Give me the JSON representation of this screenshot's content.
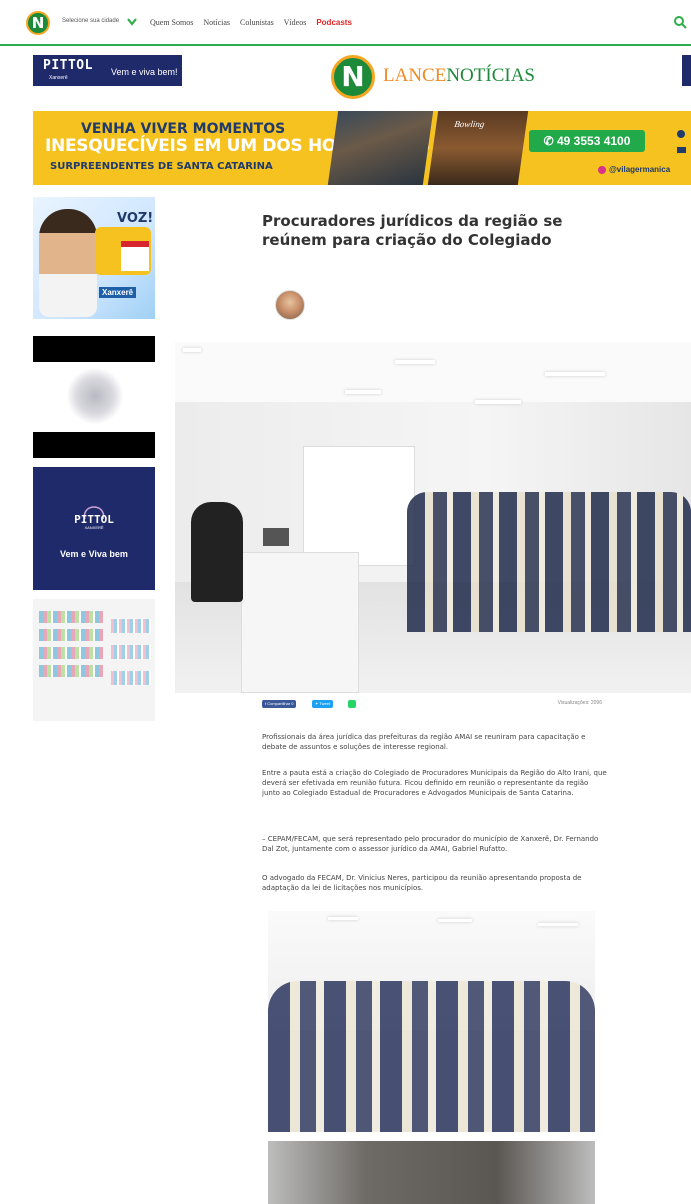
{
  "nav": {
    "city_select": "Selecione sua cidade",
    "links": [
      "Quem Somos",
      "Notícias",
      "Colunistas",
      "Vídeos"
    ],
    "podcasts": "Podcasts",
    "logo_letter": "N"
  },
  "header": {
    "ad_pittol": {
      "brand": "PITTOL",
      "sub": "Xanxerê",
      "tagline": "Vem e viva bem!"
    },
    "logo": {
      "letter": "N",
      "brand_part1": "LANCE",
      "brand_part2": "NOTÍCIAS"
    }
  },
  "hotel_banner": {
    "line1": "VENHA VIVER MOMENTOS",
    "line2": "INESQUECÍVEIS EM UM DOS HOTÉIS MAIS",
    "line3": "SURPREENDENTES DE SANTA CATARINA",
    "photo_caption": "Bowling",
    "phone": "49 3553 4100",
    "instagram": "@vilagermanica"
  },
  "sidebar": {
    "ad_voz": {
      "headline": "VOZ!",
      "brand": "Xanxerê"
    },
    "ad_pittol": {
      "brand": "PITTOL",
      "sub": "XANXERÊ",
      "tagline": "Vem e Viva bem"
    }
  },
  "article": {
    "title": "Procuradores jurídicos da região se reúnem para criação do Colegiado",
    "share_facebook": "Compartilhar",
    "share_twitter": "Tweet",
    "views": "Visualizações: 2096",
    "paragraphs": [
      "Profissionais da área jurídica das prefeituras da região AMAI se reuniram para capacitação e debate de assuntos e soluções de interesse regional.",
      "Entre a pauta está a criação do Colegiado de Procuradores Municipais da Região do Alto Irani, que deverá ser efetivada em reunião futura. Ficou definido em reunião o representante da região junto ao Colegiado Estadual de Procuradores e Advogados Municipais de Santa Catarina.",
      "– CEPAM/FECAM, que será representado pelo procurador do município de Xanxerê, Dr. Fernando Dal Zot, juntamente com o assessor jurídico da AMAI, Gabriel Rufatto.",
      "O advogado da FECAM, Dr. Vinicius Neres, participou da reunião apresentando proposta de adaptação da lei de licitações nos municípios."
    ]
  }
}
